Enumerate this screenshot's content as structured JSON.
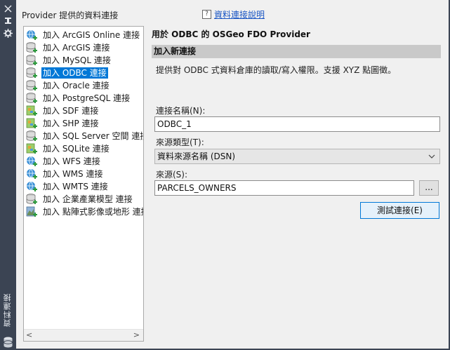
{
  "side_strip": {
    "title": "資料連接",
    "buttons": [
      "pin-icon",
      "close-panel-icon",
      "settings-icon"
    ],
    "bottom_icon": "database-icon"
  },
  "provider_label": "Provider 提供的資料連接",
  "help": {
    "icon": "help-question-icon",
    "link": "資料連接說明"
  },
  "providers": [
    {
      "label": "加入 ArcGIS Online 連接",
      "icon": "globe-icon"
    },
    {
      "label": "加入 ArcGIS 連接",
      "icon": "database-icon"
    },
    {
      "label": "加入 MySQL 連接",
      "icon": "database-icon"
    },
    {
      "label": "加入 ODBC 連接",
      "icon": "database-icon",
      "selected": true
    },
    {
      "label": "加入 Oracle 連接",
      "icon": "database-icon"
    },
    {
      "label": "加入 PostgreSQL 連接",
      "icon": "database-icon"
    },
    {
      "label": "加入 SDF 連接",
      "icon": "file-map-icon"
    },
    {
      "label": "加入 SHP 連接",
      "icon": "file-map-icon"
    },
    {
      "label": "加入 SQL Server 空間 連接",
      "icon": "database-icon"
    },
    {
      "label": "加入 SQLite 連接",
      "icon": "file-map-icon"
    },
    {
      "label": "加入 WFS 連接",
      "icon": "globe-icon"
    },
    {
      "label": "加入 WMS 連接",
      "icon": "globe-icon"
    },
    {
      "label": "加入 WMTS 連接",
      "icon": "globe-icon"
    },
    {
      "label": "加入 企業產業模型 連接",
      "icon": "database-icon"
    },
    {
      "label": "加入 點陣式影像或地形 連接",
      "icon": "raster-icon"
    }
  ],
  "detail": {
    "title": "用於 ODBC 的 OSGeo FDO Provider",
    "section_header": "加入新連接",
    "description": "提供對 ODBC 式資料倉庫的讀取/寫入權限。支援 XYZ 點圖徵。",
    "connection_name_label": "連接名稱(N):",
    "connection_name_value": "ODBC_1",
    "source_type_label": "來源類型(T):",
    "source_type_value": "資料來源名稱 (DSN)",
    "source_label": "來源(S):",
    "source_value": "PARCELS_OWNERS",
    "browse_label": "...",
    "test_button": "測試連接(E)"
  },
  "colors": {
    "selection": "#0078d7",
    "strip": "#3b4453",
    "section_header": "#c9c9c9",
    "link": "#1a56c4"
  }
}
